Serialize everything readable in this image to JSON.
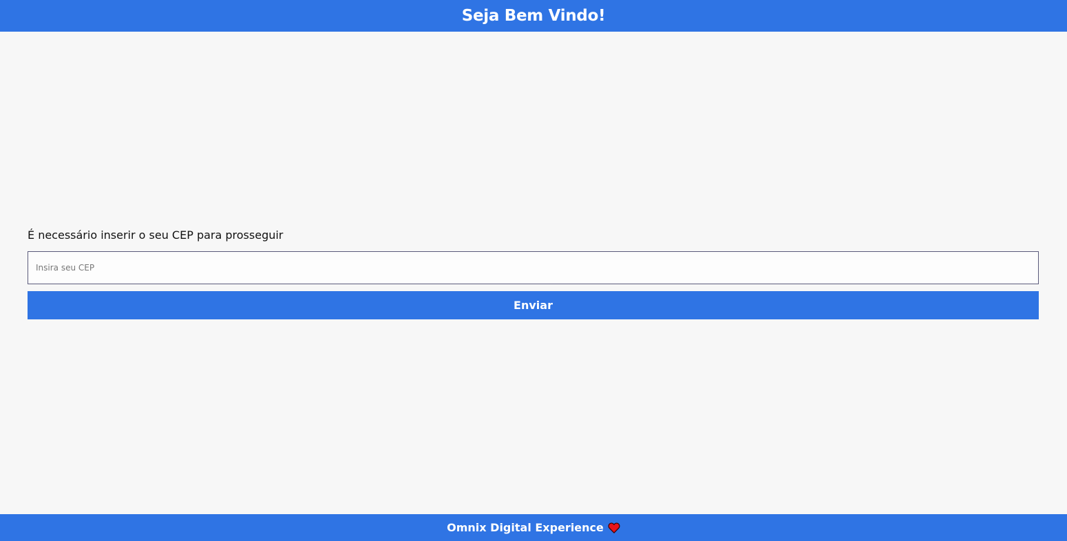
{
  "header": {
    "title": "Seja Bem Vindo!"
  },
  "form": {
    "prompt": "É necessário inserir o seu CEP para prosseguir",
    "cep_input": {
      "value": "",
      "placeholder": "Insira seu CEP"
    },
    "submit_label": "Enviar"
  },
  "footer": {
    "text": "Omnix Digital Experience",
    "icon": "heart-icon"
  },
  "colors": {
    "brand": "#2f74e4",
    "background": "#f7f7f7",
    "heart": "#e8141b"
  }
}
